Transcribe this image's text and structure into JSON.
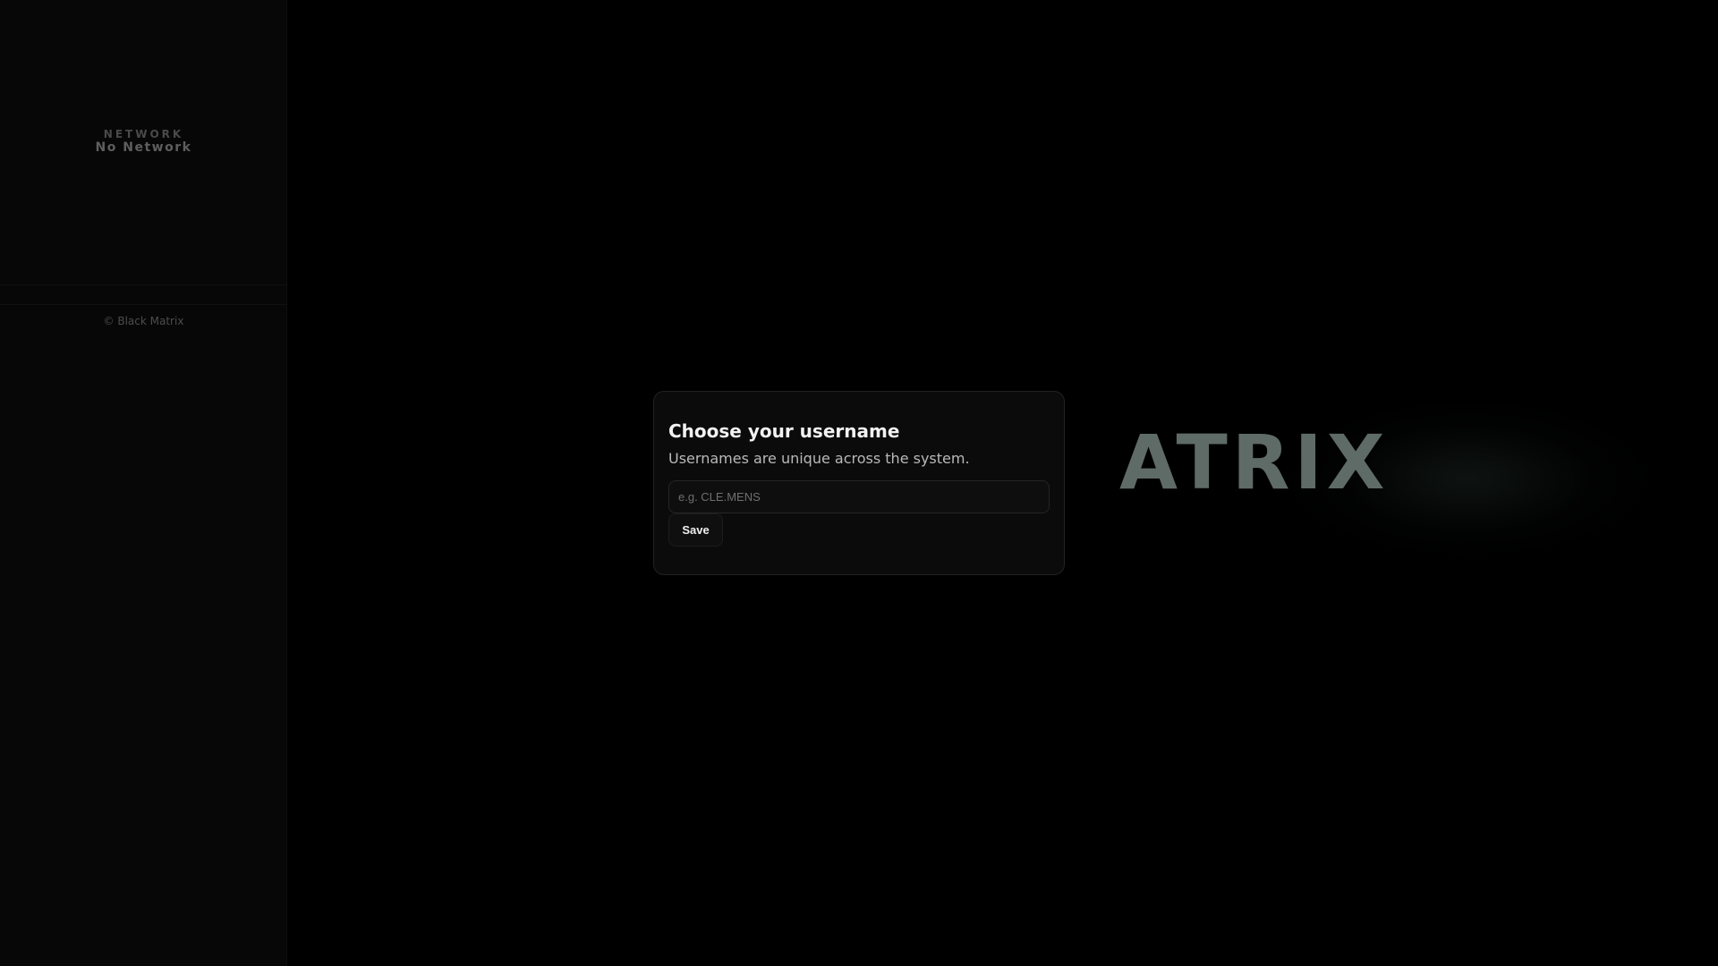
{
  "sidebar": {
    "network_label": "NETWORK",
    "network_value": "No Network",
    "footer": "© Black Matrix"
  },
  "brand": {
    "wordmark": "ATRIX"
  },
  "modal": {
    "title": "Choose your username",
    "subtitle": "Usernames are unique across the system.",
    "input_placeholder": "e.g. CLE.MENS",
    "input_value": "",
    "save_label": "Save"
  },
  "colors": {
    "background": "#000000",
    "sidebar": "#070707",
    "modal": "#0b0b0b",
    "wordmark": "#5f6b66"
  }
}
